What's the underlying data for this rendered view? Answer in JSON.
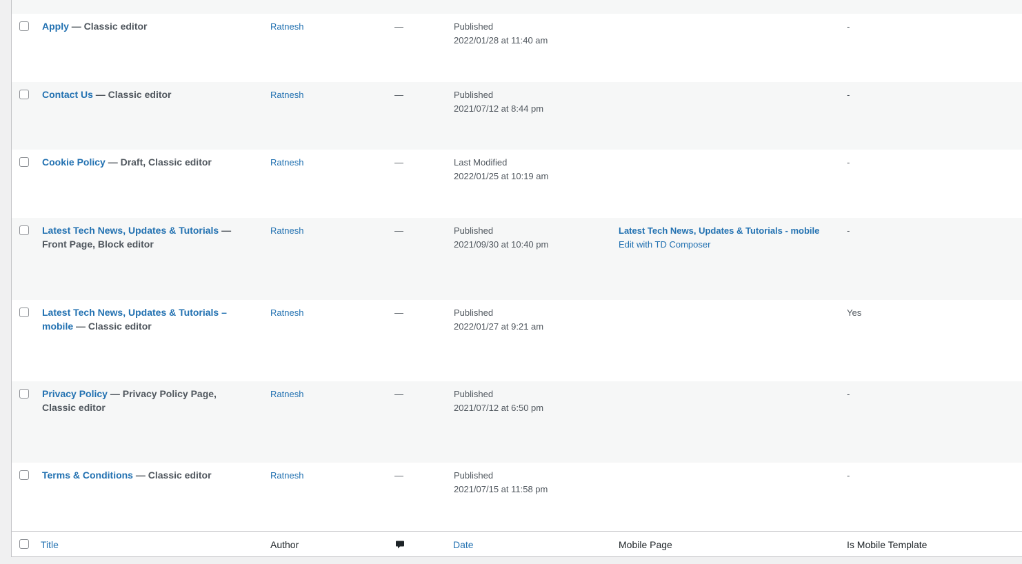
{
  "rows": [
    {
      "title": "Apply",
      "state": " — Classic editor",
      "author": "Ratnesh",
      "comments": "—",
      "date_status": "Published",
      "date_value": "2022/01/28 at 11:40 am",
      "mobile_title": "",
      "mobile_edit": "",
      "is_mobile": "-"
    },
    {
      "title": "Contact Us",
      "state": " — Classic editor",
      "author": "Ratnesh",
      "comments": "—",
      "date_status": "Published",
      "date_value": "2021/07/12 at 8:44 pm",
      "mobile_title": "",
      "mobile_edit": "",
      "is_mobile": "-"
    },
    {
      "title": "Cookie Policy",
      "state": " — Draft, Classic editor",
      "author": "Ratnesh",
      "comments": "—",
      "date_status": "Last Modified",
      "date_value": "2022/01/25 at 10:19 am",
      "mobile_title": "",
      "mobile_edit": "",
      "is_mobile": "-"
    },
    {
      "title": "Latest Tech News, Updates & Tutorials",
      "state": " — Front Page, Block editor",
      "author": "Ratnesh",
      "comments": "—",
      "date_status": "Published",
      "date_value": "2021/09/30 at 10:40 pm",
      "mobile_title": "Latest Tech News, Updates & Tutorials - mobile",
      "mobile_edit": "Edit with TD Composer",
      "is_mobile": "-"
    },
    {
      "title": "Latest Tech News, Updates & Tutorials – mobile",
      "state": " — Classic editor",
      "author": "Ratnesh",
      "comments": "—",
      "date_status": "Published",
      "date_value": "2022/01/27 at 9:21 am",
      "mobile_title": "",
      "mobile_edit": "",
      "is_mobile": "Yes"
    },
    {
      "title": "Privacy Policy",
      "state": " — Privacy Policy Page, Classic editor",
      "author": "Ratnesh",
      "comments": "—",
      "date_status": "Published",
      "date_value": "2021/07/12 at 6:50 pm",
      "mobile_title": "",
      "mobile_edit": "",
      "is_mobile": "-"
    },
    {
      "title": "Terms & Conditions",
      "state": " — Classic editor",
      "author": "Ratnesh",
      "comments": "—",
      "date_status": "Published",
      "date_value": "2021/07/15 at 11:58 pm",
      "mobile_title": "",
      "mobile_edit": "",
      "is_mobile": "-"
    }
  ],
  "footer": {
    "title": "Title",
    "author": "Author",
    "comments_icon": "comment-bubble-icon",
    "date": "Date",
    "mobile_page": "Mobile Page",
    "is_mobile_template": "Is Mobile Template"
  },
  "colors": {
    "link": "#2271b1",
    "text": "#50575e",
    "alt_row": "#f6f7f7",
    "border": "#c3c4c7"
  }
}
